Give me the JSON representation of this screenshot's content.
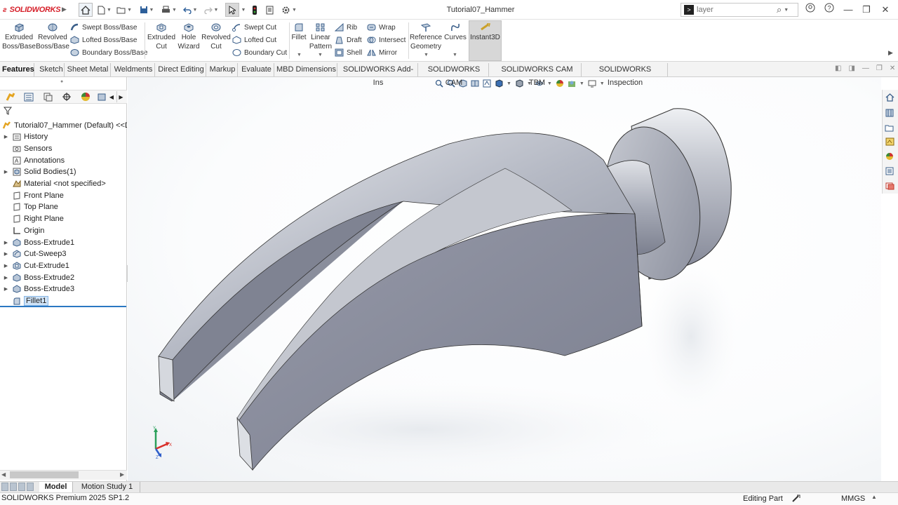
{
  "app": {
    "brand": "SOLIDWORKS",
    "document_title": "Tutorial07_Hammer"
  },
  "search": {
    "placeholder": "layer"
  },
  "ribbon": {
    "extruded_boss": "Extruded\nBoss/Base",
    "revolved_boss": "Revolved\nBoss/Base",
    "swept_boss": "Swept Boss/Base",
    "lofted_boss": "Lofted Boss/Base",
    "boundary_boss": "Boundary Boss/Base",
    "extruded_cut": "Extruded\nCut",
    "hole_wizard": "Hole\nWizard",
    "revolved_cut": "Revolved\nCut",
    "swept_cut": "Swept Cut",
    "lofted_cut": "Lofted Cut",
    "boundary_cut": "Boundary Cut",
    "fillet": "Fillet",
    "linear_pattern": "Linear\nPattern",
    "rib": "Rib",
    "draft": "Draft",
    "shell": "Shell",
    "wrap": "Wrap",
    "intersect": "Intersect",
    "mirror": "Mirror",
    "reference_geometry": "Reference\nGeometry",
    "curves": "Curves",
    "instant3d": "Instant3D"
  },
  "tabs": [
    "Features",
    "Sketch",
    "Sheet Metal",
    "Weldments",
    "Direct Editing",
    "Markup",
    "Evaluate",
    "MBD Dimensions",
    "SOLIDWORKS Add-Ins",
    "SOLIDWORKS CAM",
    "SOLIDWORKS CAM TBM",
    "SOLIDWORKS Inspection"
  ],
  "tree": {
    "root": "Tutorial07_Hammer (Default) <<Def",
    "items": [
      "History",
      "Sensors",
      "Annotations",
      "Solid Bodies(1)",
      "Material <not specified>",
      "Front Plane",
      "Top Plane",
      "Right Plane",
      "Origin",
      "Boss-Extrude1",
      "Cut-Sweep3",
      "Cut-Extrude1",
      "Boss-Extrude2",
      "Boss-Extrude3",
      "Fillet1"
    ]
  },
  "bottom_tabs": {
    "model": "Model",
    "motion": "Motion Study 1"
  },
  "status": {
    "left": "SOLIDWORKS Premium 2025 SP1.2",
    "mode": "Editing Part",
    "units": "MMGS"
  },
  "colors": {
    "accent": "#d6202a",
    "selection": "#2b78c2",
    "instant3d_bg": "#d7d7d7"
  }
}
